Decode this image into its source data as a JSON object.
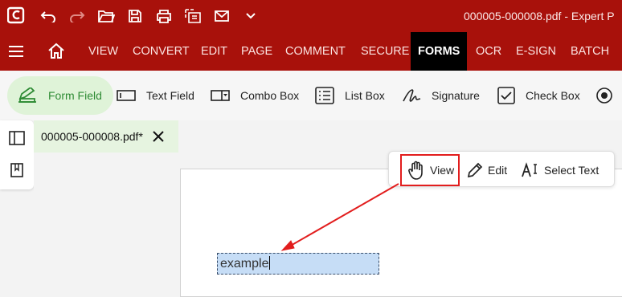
{
  "app": {
    "window_title": "000005-000008.pdf  -  Expert P",
    "accent_color": "#a8110b"
  },
  "quick_access": [
    {
      "icon": "undo-icon"
    },
    {
      "icon": "redo-icon"
    },
    {
      "icon": "open-folder-icon"
    },
    {
      "icon": "save-icon"
    },
    {
      "icon": "print-icon"
    },
    {
      "icon": "scan-icon"
    },
    {
      "icon": "mail-icon"
    },
    {
      "icon": "chevron-down-icon"
    }
  ],
  "menu": {
    "items": [
      {
        "label": "VIEW"
      },
      {
        "label": "CONVERT"
      },
      {
        "label": "EDIT"
      },
      {
        "label": "PAGE"
      },
      {
        "label": "COMMENT"
      },
      {
        "label": "SECURE"
      },
      {
        "label": "FORMS",
        "active": true
      },
      {
        "label": "OCR"
      },
      {
        "label": "E-SIGN"
      },
      {
        "label": "BATCH"
      }
    ]
  },
  "forms_toolbar": {
    "tools": [
      {
        "label": "Form Field",
        "icon": "form-field-icon",
        "active": true
      },
      {
        "label": "Text Field",
        "icon": "text-field-icon"
      },
      {
        "label": "Combo Box",
        "icon": "combo-box-icon"
      },
      {
        "label": "List Box",
        "icon": "list-box-icon"
      },
      {
        "label": "Signature",
        "icon": "signature-icon"
      },
      {
        "label": "Check Box",
        "icon": "check-box-icon"
      },
      {
        "label": "",
        "icon": "radio-button-icon"
      }
    ],
    "active_color": "#2e8b34"
  },
  "document_tab": {
    "label": "000005-000008.pdf*"
  },
  "mode_bar": {
    "view_label": "View",
    "edit_label": "Edit",
    "select_text_label": "Select Text"
  },
  "form_field": {
    "value": "example"
  },
  "annotation": {
    "color": "#e21d1d"
  }
}
